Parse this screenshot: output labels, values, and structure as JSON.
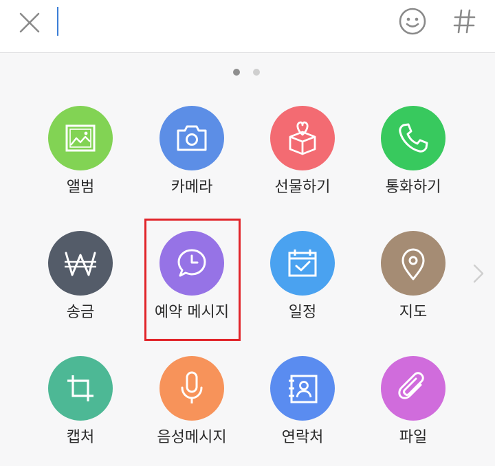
{
  "input": {
    "value": "",
    "placeholder": ""
  },
  "icons": {
    "close": "close-icon",
    "emoji": "smiley-icon",
    "hashtag": "hashtag-icon",
    "next": "chevron-right-icon"
  },
  "pagination": {
    "current": 1,
    "total": 2
  },
  "colors": {
    "album": "#82d354",
    "camera": "#5c8ee6",
    "gift": "#f36b72",
    "call": "#38c95e",
    "transfer": "#545c69",
    "schedule_msg": "#9673e6",
    "calendar": "#4aa2f0",
    "map": "#a58c74",
    "capture": "#4db895",
    "voice": "#f7935a",
    "contacts": "#5a8cf0",
    "file": "#d06cdc",
    "highlight": "#e1242a"
  },
  "menu": [
    {
      "id": "album",
      "label": "앨범",
      "icon": "image-icon"
    },
    {
      "id": "camera",
      "label": "카메라",
      "icon": "camera-icon"
    },
    {
      "id": "gift",
      "label": "선물하기",
      "icon": "gift-box-icon"
    },
    {
      "id": "call",
      "label": "통화하기",
      "icon": "phone-icon"
    },
    {
      "id": "transfer",
      "label": "송금",
      "icon": "won-icon"
    },
    {
      "id": "schedule_msg",
      "label": "예약 메시지",
      "icon": "clock-message-icon"
    },
    {
      "id": "calendar",
      "label": "일정",
      "icon": "calendar-check-icon"
    },
    {
      "id": "map",
      "label": "지도",
      "icon": "map-pin-icon"
    },
    {
      "id": "capture",
      "label": "캡처",
      "icon": "crop-icon"
    },
    {
      "id": "voice",
      "label": "음성메시지",
      "icon": "microphone-icon"
    },
    {
      "id": "contacts",
      "label": "연락처",
      "icon": "contact-card-icon"
    },
    {
      "id": "file",
      "label": "파일",
      "icon": "paperclip-icon"
    }
  ]
}
